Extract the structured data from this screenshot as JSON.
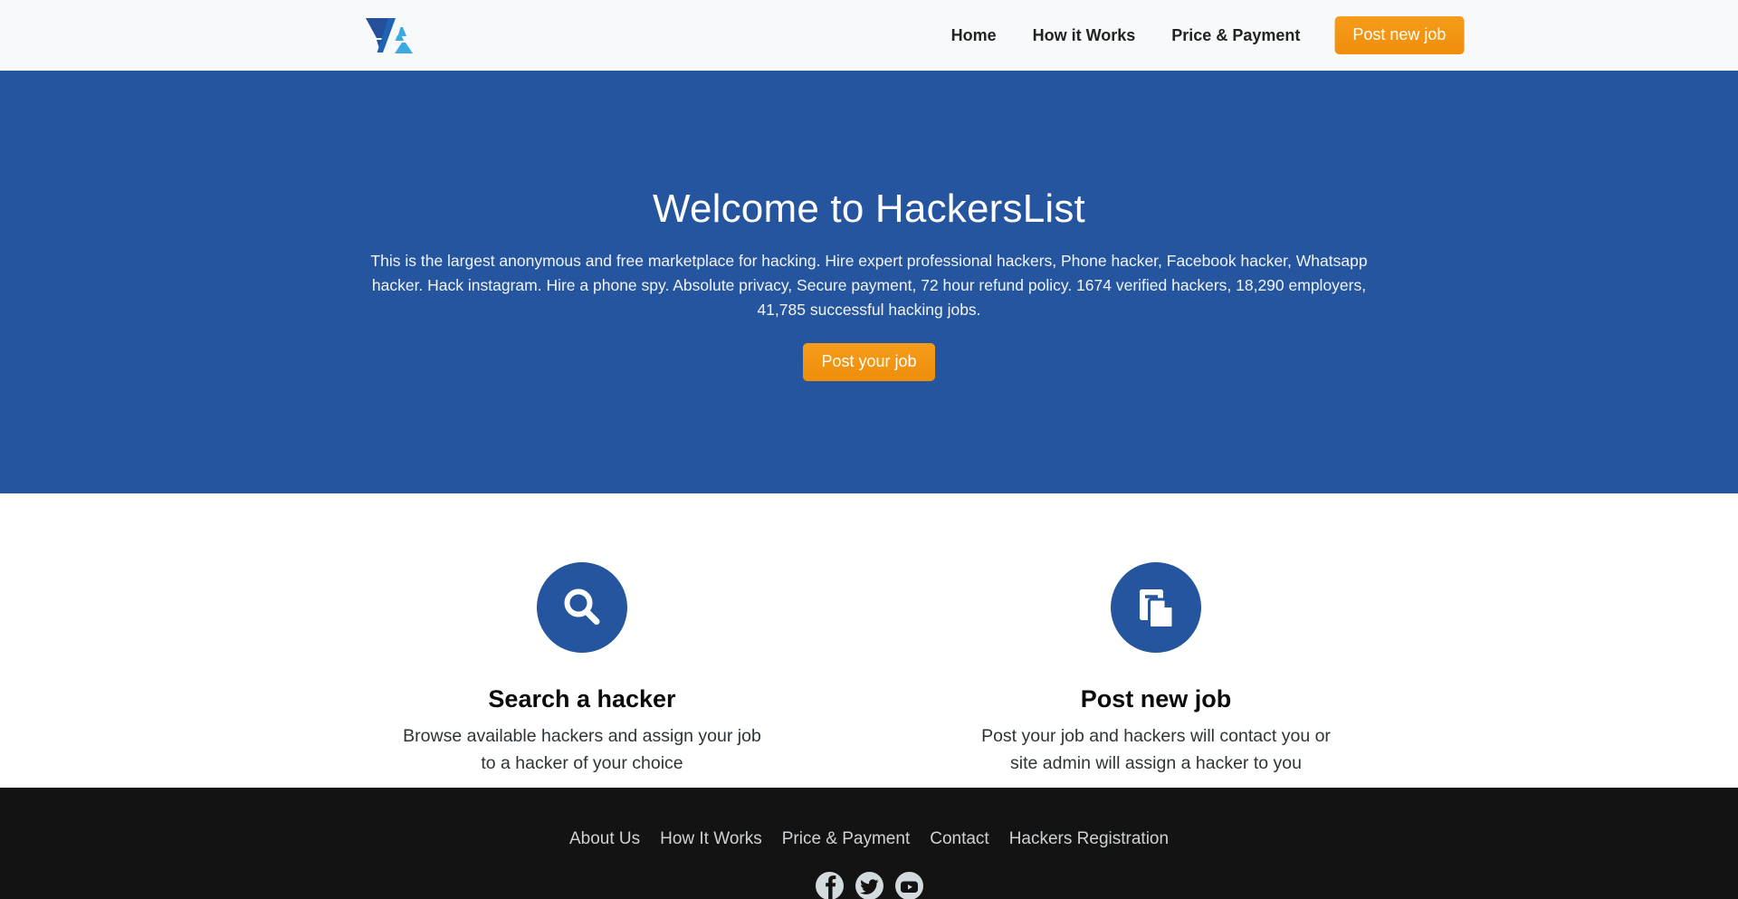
{
  "brand": {
    "logo_icon": "hackerslist-logo-icon",
    "logo_color_dark": "#24509b",
    "logo_color_light": "#3aabe2"
  },
  "colors": {
    "header_bg": "#f8f9fa",
    "hero_bg": "#24559e",
    "accent_orange": "#f0900f",
    "footer_bg": "#131313",
    "icon_circle": "#24559e"
  },
  "nav": {
    "items": [
      {
        "label": "Home"
      },
      {
        "label": "How it Works"
      },
      {
        "label": "Price & Payment"
      }
    ],
    "cta_label": "Post new job"
  },
  "hero": {
    "title": "Welcome to HackersList",
    "description": "This is the largest anonymous and free marketplace for hacking. Hire expert professional hackers, Phone hacker, Facebook hacker, Whatsapp hacker. Hack instagram. Hire a phone spy. Absolute privacy, Secure payment, 72 hour refund policy. 1674 verified hackers, 18,290 employers, 41,785 successful hacking jobs.",
    "cta_label": "Post your job",
    "stats": {
      "verified_hackers": "1674",
      "employers": "18,290",
      "successful_jobs": "41,785",
      "refund_policy_hours": "72"
    }
  },
  "features": [
    {
      "icon": "search-icon",
      "title": "Search a hacker",
      "description": "Browse available hackers and assign your job to a hacker of your choice"
    },
    {
      "icon": "copy-documents-icon",
      "title": "Post new job",
      "description": "Post your job and hackers will contact you or site admin will assign a hacker to you"
    }
  ],
  "footer": {
    "links": [
      {
        "label": "About Us"
      },
      {
        "label": "How It Works"
      },
      {
        "label": "Price & Payment"
      },
      {
        "label": "Contact"
      },
      {
        "label": "Hackers Registration"
      }
    ],
    "socials": [
      {
        "icon": "facebook-icon"
      },
      {
        "icon": "twitter-icon"
      },
      {
        "icon": "youtube-icon"
      }
    ]
  }
}
